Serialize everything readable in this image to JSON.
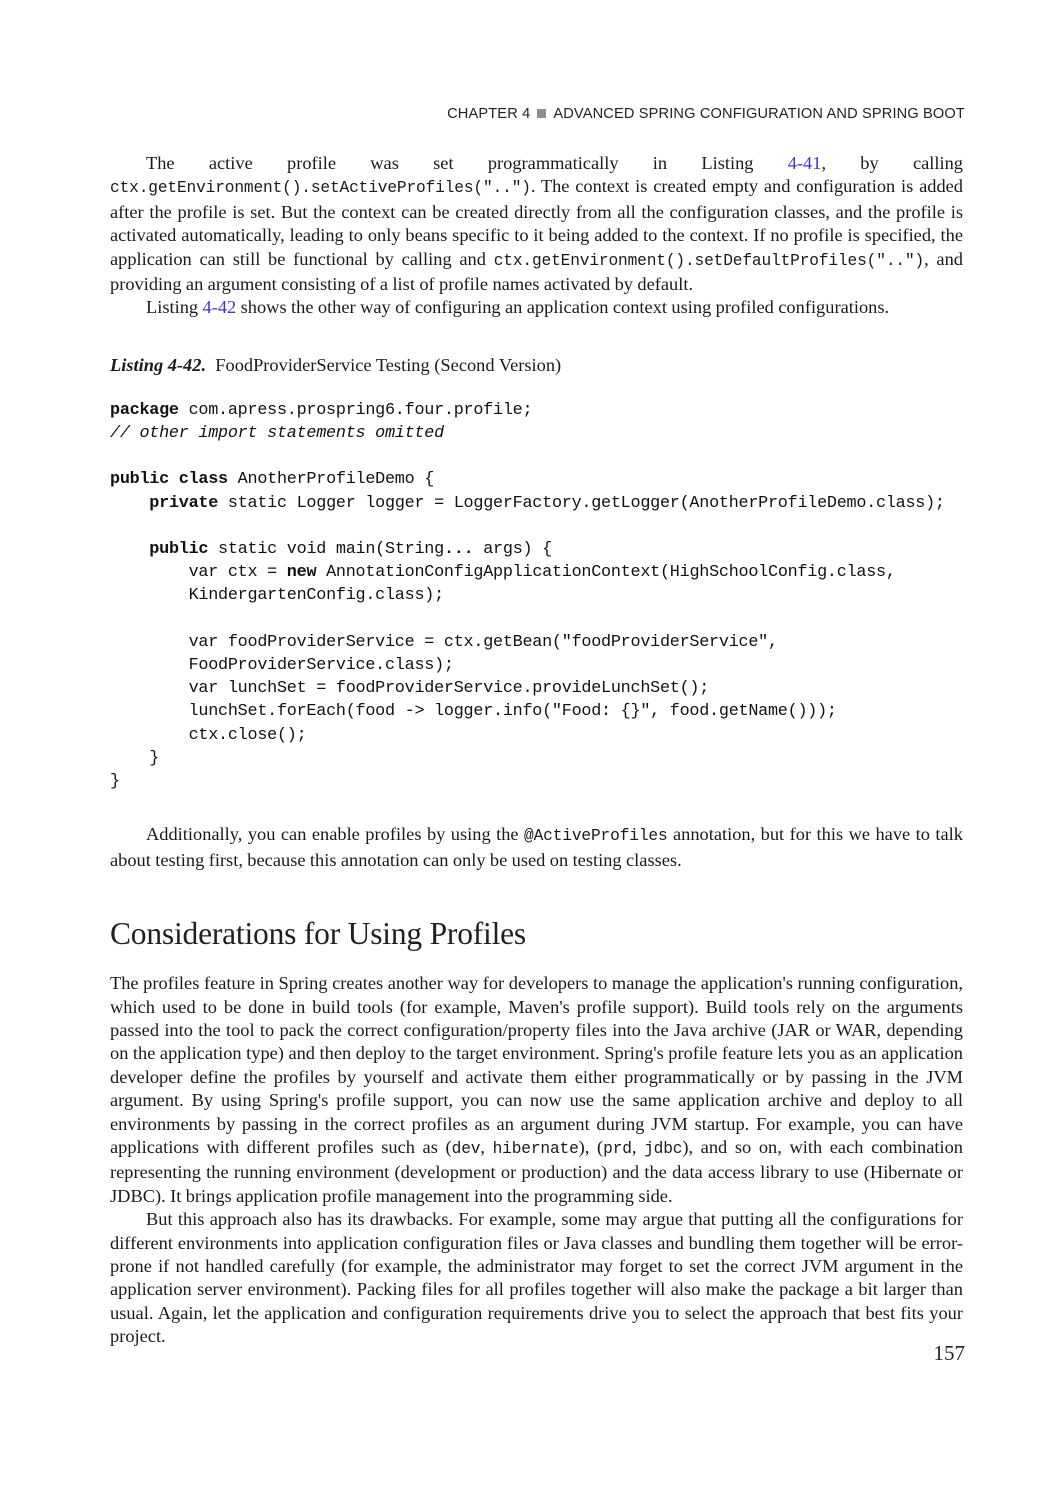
{
  "header": {
    "chapter_label": "CHAPTER 4",
    "separator_icon": "gray-square-bullet",
    "chapter_title": "ADVANCED SPRING CONFIGURATION AND SPRING BOOT"
  },
  "paragraphs": {
    "p1_part1": "The active profile was set programmatically in Listing ",
    "p1_link1": "4-41",
    "p1_part2": ", by calling ",
    "p1_code1": "ctx.getEnvironment().setActiveProfiles(\"..\")",
    "p1_part3": ". The context is created empty and configuration is added after the profile is set. But the context can be created directly from all the configuration classes, and the profile is activated automatically, leading to only beans specific to it being added to the context. If no profile is specified, the application can still be functional by calling and ",
    "p1_code2": "ctx.getEnvironment().setDefaultProfiles(\"..\")",
    "p1_part4": ", and providing an argument consisting of a list of profile names activated by default.",
    "p2_part1": "Listing ",
    "p2_link1": "4-42",
    "p2_part2": " shows the other way of configuring an application context using profiled configurations.",
    "p3_part1": "Additionally, you can enable profiles by using the ",
    "p3_code1": "@ActiveProfiles",
    "p3_part2": " annotation, but for this we have to talk about testing first, because this annotation can only be used on testing classes.",
    "p4": "The profiles feature in Spring creates another way for developers to manage the application's running configuration, which used to be done in build tools (for example, Maven's profile support). Build tools rely on the arguments passed into the tool to pack the correct configuration/property files into the Java archive (JAR or WAR, depending on the application type) and then deploy to the target environment. Spring's profile feature lets you as an application developer define the profiles by yourself and activate them either programmatically or by passing in the JVM argument. By using Spring's profile support, you can now use the same application archive and deploy to all environments by passing in the correct profiles as an argument during JVM startup. For example, you can have applications with different profiles such as ",
    "p4_code1": "dev",
    "p4_code1b": ", ",
    "p4_code2": "hibernate",
    "p4_mid": "), (",
    "p4_code3": "prd",
    "p4_code4": "jdbc",
    "p4_part2": "), and so on, with each combination representing the running environment (development or production) and the data access library to use (Hibernate or JDBC). It brings application profile management into the programming side.",
    "p5": "But this approach also has its drawbacks. For example, some may argue that putting all the configurations for different environments into application configuration files or Java classes and bundling them together will be error-prone if not handled carefully (for example, the administrator may forget to set the correct JVM argument in the application server environment). Packing files for all profiles together will also make the package a bit larger than usual. Again, let the application and configuration requirements drive you to select the approach that best fits your project."
  },
  "listing": {
    "caption_number": "Listing 4-42.",
    "caption_title": "FoodProviderService Testing (Second Version)",
    "code_lines": [
      "package com.apress.prospring6.four.profile;",
      "// other import statements omitted",
      "",
      "public class AnotherProfileDemo {",
      "    private static Logger logger = LoggerFactory.getLogger(AnotherProfileDemo.class);",
      "",
      "    public static void main(String... args) {",
      "        var ctx = new AnnotationConfigApplicationContext(HighSchoolConfig.class,",
      "        KindergartenConfig.class);",
      "",
      "        var foodProviderService = ctx.getBean(\"foodProviderService\",",
      "        FoodProviderService.class);",
      "        var lunchSet = foodProviderService.provideLunchSet();",
      "        lunchSet.forEach(food -> logger.info(\"Food: {}\", food.getName()));",
      "        ctx.close();",
      "    }",
      "}"
    ]
  },
  "section": {
    "heading": "Considerations for Using Profiles"
  },
  "footer": {
    "page_number": "157"
  },
  "colors": {
    "link": "#3b38c8",
    "text": "#1a1a1a",
    "header_rule": "#8d8d8d"
  }
}
